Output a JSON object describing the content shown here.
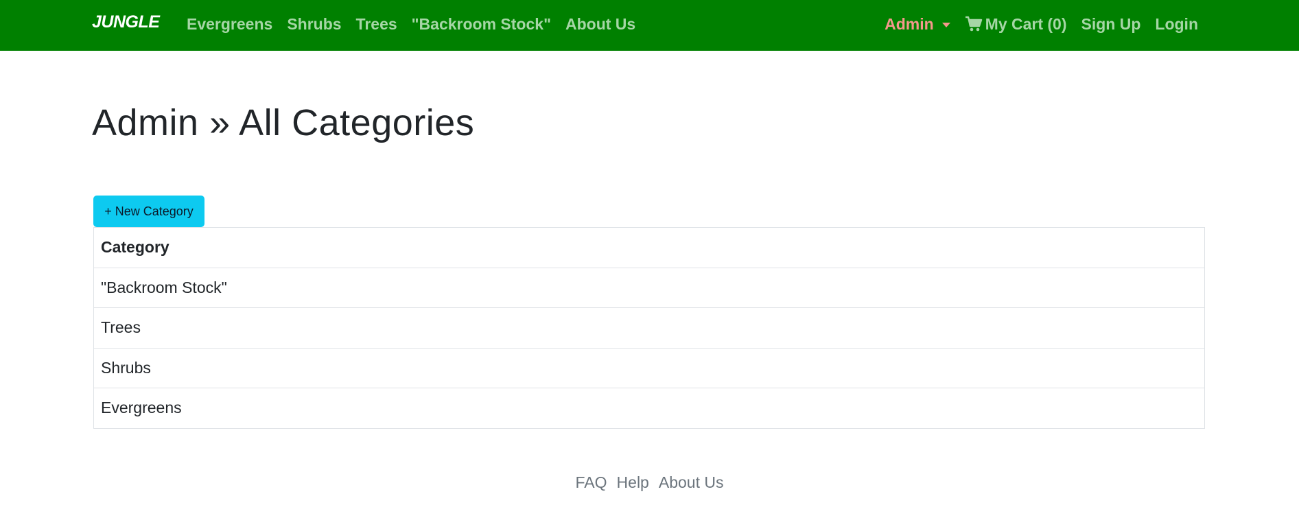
{
  "navbar": {
    "brand": "JUNGLE",
    "left_links": [
      "Evergreens",
      "Shrubs",
      "Trees",
      "\"Backroom Stock\"",
      "About Us"
    ],
    "admin_label": "Admin",
    "cart_label": "My Cart (0)",
    "signup_label": "Sign Up",
    "login_label": "Login"
  },
  "main": {
    "title": "Admin » All Categories",
    "new_button_label": "+ New Category",
    "table": {
      "header": "Category",
      "rows": [
        "\"Backroom Stock\"",
        "Trees",
        "Shrubs",
        "Evergreens"
      ]
    }
  },
  "footer": {
    "links": [
      "FAQ",
      "Help",
      "About Us"
    ]
  },
  "colors": {
    "navbar_bg": "#008000",
    "nav_link": "#a6d6a6",
    "admin_link": "#f5988c",
    "button_bg": "#0dcaf0"
  }
}
